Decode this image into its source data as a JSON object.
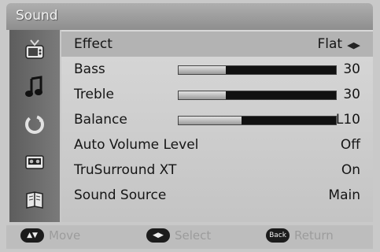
{
  "window": {
    "title": "Sound"
  },
  "menu": {
    "items": [
      {
        "label": "Effect",
        "value": "Flat",
        "has_arrows": true,
        "active": true
      },
      {
        "label": "Bass",
        "value": "30",
        "level": 0.3
      },
      {
        "label": "Treble",
        "value": "30",
        "level": 0.3
      },
      {
        "label": "Balance",
        "value": "L10",
        "level": 0.4
      },
      {
        "label": "Auto Volume Level",
        "value": "Off"
      },
      {
        "label": "TruSurround XT",
        "value": "On"
      },
      {
        "label": "Sound Source",
        "value": "Main"
      }
    ]
  },
  "sidebar": {
    "icons": [
      "tv-icon",
      "music-note-icon",
      "refresh-icon",
      "cassette-icon",
      "book-icon"
    ]
  },
  "hints": {
    "move_label": "Move",
    "select_label": "Select",
    "back_key": "Back",
    "return_label": "Return"
  },
  "colors": {
    "active_row": "#b3b3b3",
    "bar_track": "#111111",
    "bar_fill": "#cfcfcf"
  }
}
